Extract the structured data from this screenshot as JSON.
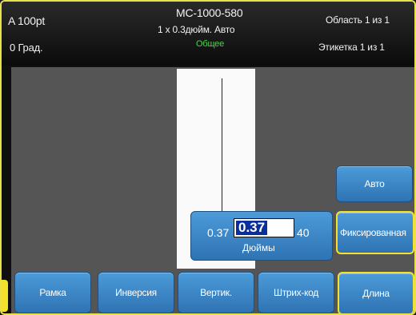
{
  "status": {
    "font_size": "A 100pt",
    "rotation": "0 Град.",
    "cartridge": "MC-1000-580",
    "label_size": "1 x 0.3дюйм. Авто",
    "mode": "Общее",
    "area_counter": "Область 1 из 1",
    "label_counter": "Этикетка 1 из 1"
  },
  "length_input": {
    "min": "0.37",
    "value": "0.37",
    "max": "40",
    "unit": "Дюймы"
  },
  "side_buttons": {
    "auto": "Авто",
    "fixed": "Фиксированная",
    "length": "Длина"
  },
  "bottom_buttons": {
    "frame": "Рамка",
    "invert": "Инверсия",
    "vertical": "Вертик.",
    "barcode": "Штрих-код"
  },
  "colors": {
    "accent_yellow": "#f4e12c",
    "button_blue": "#3a86c8",
    "mode_green": "#4fd44f",
    "selection_blue": "#0a2f9c"
  }
}
